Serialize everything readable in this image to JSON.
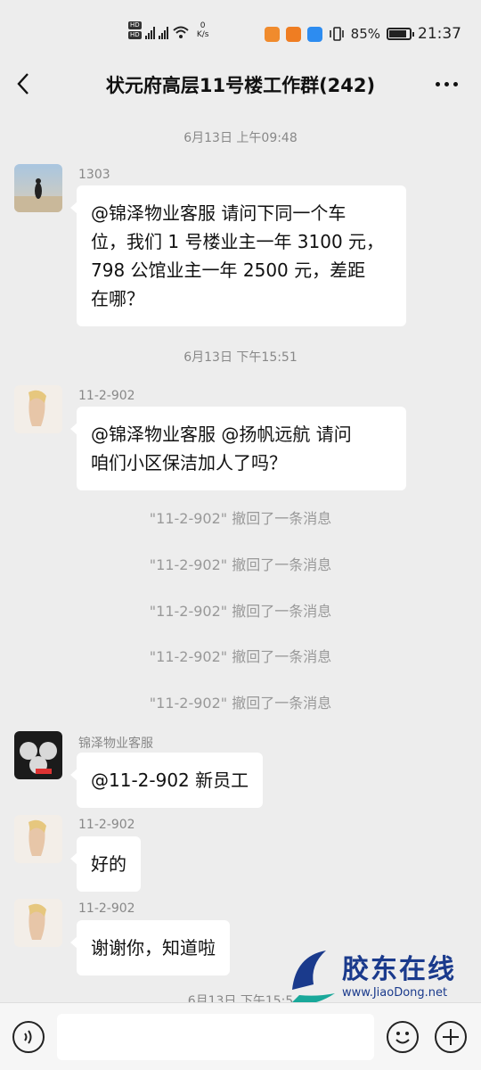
{
  "status": {
    "net_speed_value": "0",
    "net_speed_unit": "K/s",
    "battery": "85%",
    "time": "21:37"
  },
  "header": {
    "title": "状元府高层11号楼工作群(242)"
  },
  "messages": [
    {
      "time": "6月13日 上午09:48"
    },
    {
      "sender": "1303",
      "text_lines": [
        "@锦泽物业客服  请问下同一个车",
        "位，我们 1 号楼业主一年 3100 元，",
        "798 公馆业主一年 2500 元，差距",
        "在哪？"
      ]
    },
    {
      "time": "6月13日 下午15:51"
    },
    {
      "sender": "11-2-902",
      "text_lines": [
        "@锦泽物业客服 @扬帆远航  请问",
        "咱们小区保洁加人了吗？"
      ]
    },
    {
      "recall": "\"11-2-902\" 撤回了一条消息"
    },
    {
      "recall": "\"11-2-902\" 撤回了一条消息"
    },
    {
      "recall": "\"11-2-902\" 撤回了一条消息"
    },
    {
      "recall": "\"11-2-902\" 撤回了一条消息"
    },
    {
      "recall": "\"11-2-902\" 撤回了一条消息"
    },
    {
      "sender": "锦泽物业客服",
      "text": "@11-2-902  新员工"
    },
    {
      "sender": "11-2-902",
      "text": "好的"
    },
    {
      "sender": "11-2-902",
      "text": "谢谢你，知道啦"
    },
    {
      "time": "6月13日 下午15:5"
    }
  ],
  "watermark": {
    "name": "胶东在线",
    "url": "www.JiaoDong.net"
  },
  "colors": {
    "background": "#ededed",
    "bubble": "#ffffff",
    "watermark": "#1a3a8c"
  }
}
